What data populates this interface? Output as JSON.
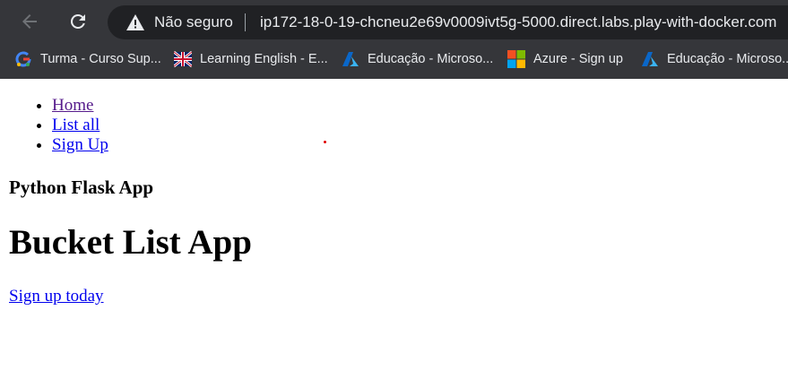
{
  "browser": {
    "security_label": "Não seguro",
    "url": "ip172-18-0-19-chcneu2e69v0009ivt5g-5000.direct.labs.play-with-docker.com",
    "icons": {
      "back": "back-arrow-icon",
      "reload": "reload-icon",
      "warning": "warning-icon"
    },
    "bookmarks": [
      {
        "label": "Turma - Curso Sup...",
        "icon": "google-classroom-icon"
      },
      {
        "label": "Learning English - E...",
        "icon": "uk-flag-icon"
      },
      {
        "label": "Educação - Microso...",
        "icon": "azure-icon"
      },
      {
        "label": "Azure - Sign up",
        "icon": "microsoft-icon"
      },
      {
        "label": "Educação - Microso...",
        "icon": "azure-icon"
      }
    ],
    "colors": {
      "chrome_bg": "#35363a",
      "omnibox_bg": "#202124",
      "text": "#e8eaed"
    }
  },
  "page": {
    "nav": [
      {
        "label": "Home"
      },
      {
        "label": "List all"
      },
      {
        "label": "Sign Up"
      }
    ],
    "tagline": "Python Flask App",
    "title": "Bucket List App",
    "cta_link": "Sign up today",
    "colors": {
      "link": "#0000ee",
      "visited_link": "#551a8b"
    }
  }
}
